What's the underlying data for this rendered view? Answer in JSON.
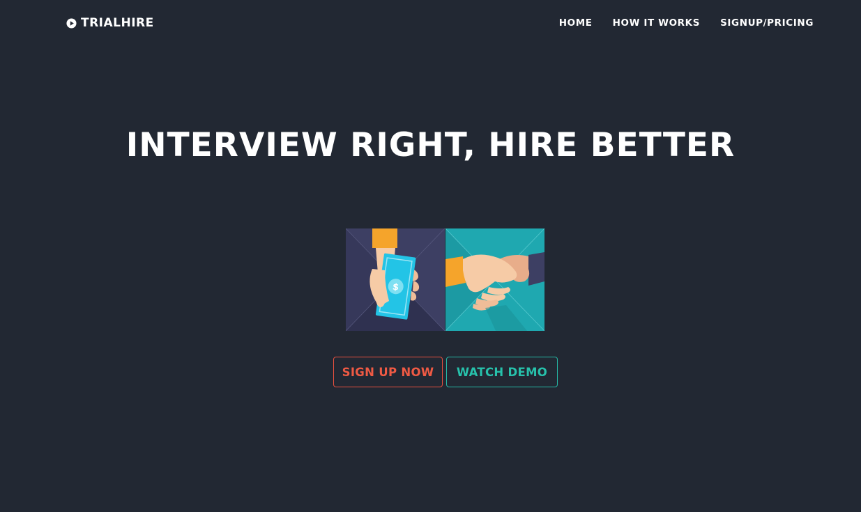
{
  "header": {
    "brand": "TRIALHIRE",
    "brand_icon": "play-circle-icon",
    "nav": [
      {
        "label": "HOME"
      },
      {
        "label": "HOW IT WORKS"
      },
      {
        "label": "SIGNUP/PRICING"
      }
    ]
  },
  "hero": {
    "title": "INTERVIEW RIGHT, HIRE BETTER",
    "illustration": {
      "left_panel": "hand-holding-money-icon",
      "right_panel": "handshake-icon"
    }
  },
  "cta": {
    "signup_label": "SIGN UP NOW",
    "demo_label": "WATCH DEMO"
  },
  "colors": {
    "background": "#222833",
    "signup_accent": "#ef5a44",
    "demo_accent": "#27c1ab",
    "panel_left": "#3d3f63",
    "panel_right": "#1fa8b0",
    "sleeve": "#f5a42b",
    "skin": "#f6cba6",
    "money": "#23c4e6"
  }
}
